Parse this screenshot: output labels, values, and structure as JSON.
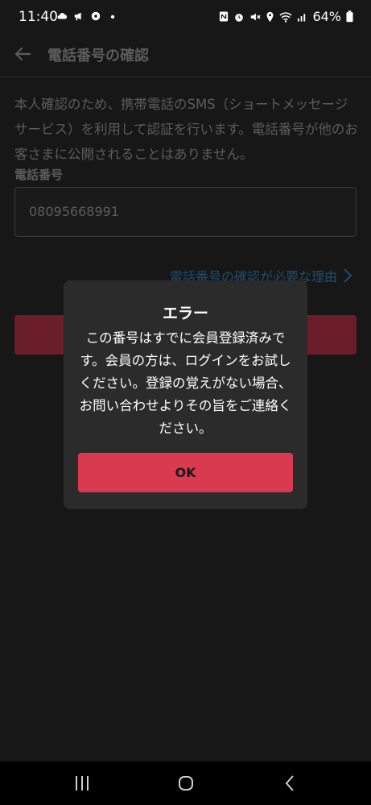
{
  "status_bar": {
    "time": "11:40",
    "battery": "64%",
    "left_icons": [
      "cloud-icon",
      "megaphone-icon",
      "app-icon",
      "dot-icon"
    ],
    "right_icons": [
      "nfc-icon",
      "alarm-icon",
      "mute-icon",
      "location-icon",
      "wifi-icon",
      "signal-icon",
      "battery-icon"
    ]
  },
  "app_bar": {
    "title": "電話番号の確認",
    "back_icon": "arrow-left-icon"
  },
  "form": {
    "description": "本人確認のため、携帯電話のSMS（ショートメッセージサービス）を利用して認証を行います。電話番号が他のお客さまに公開されることはありません。",
    "phone_label": "電話番号",
    "phone_value": "08095668991",
    "reason_link": "電話番号の確認が必要な理由"
  },
  "dialog": {
    "title": "エラー",
    "message": "この番号はすでに会員登録済みです。会員の方は、ログインをお試しください。登録の覚えがない場合、お問い合わせよりその旨をご連絡ください。",
    "ok_label": "OK"
  },
  "colors": {
    "background": "#171717",
    "dialog_bg": "#2b2b2b",
    "primary": "#d93a50",
    "dimmed_primary": "#6a1e29",
    "link": "#1e4d6b"
  },
  "nav_bar": {
    "buttons": [
      "recent-apps-icon",
      "home-icon",
      "back-icon"
    ]
  }
}
